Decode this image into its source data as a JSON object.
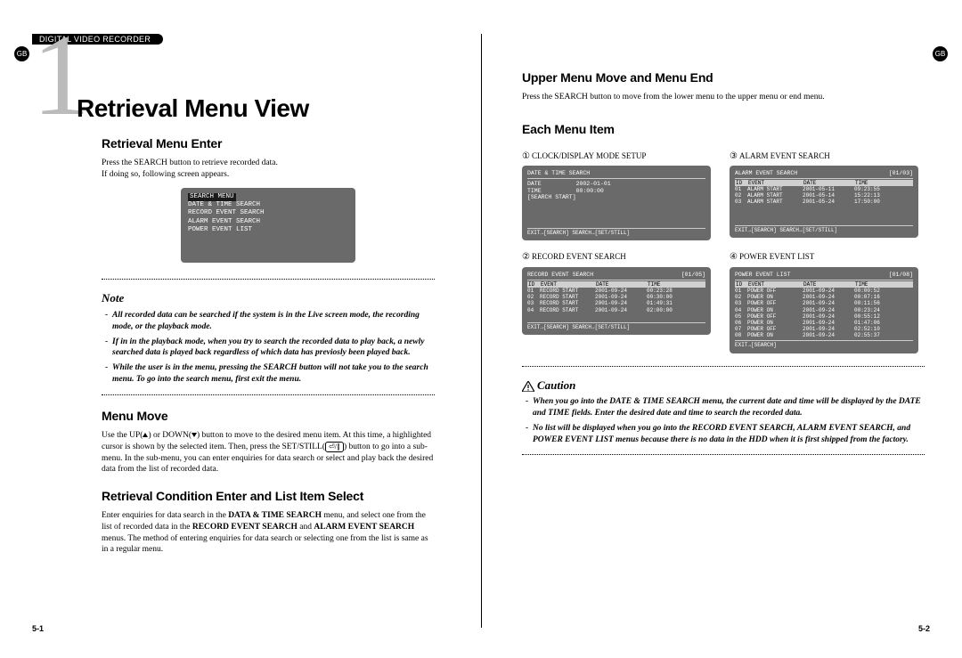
{
  "header_bar": "DIGITAL VIDEO RECORDER",
  "gb": "GB",
  "chapter_number": "1",
  "title": "Retrieval Menu View",
  "page_left": "5-1",
  "page_right": "5-2",
  "left": {
    "s1": {
      "h": "Retrieval Menu Enter",
      "p1": "Press the SEARCH button to retrieve recorded data.",
      "p2": "If doing so, following screen appears.",
      "screen": {
        "title": "SEARCH MENU",
        "items": [
          "DATE & TIME SEARCH",
          "RECORD EVENT SEARCH",
          "ALARM EVENT SEARCH",
          "POWER EVENT LIST"
        ]
      }
    },
    "note": {
      "label": "Note",
      "b1": "All recorded data can be searched if the system is in the Live screen mode, the recording mode, or the playback mode.",
      "b2": "If in in the playback mode, when you try to search the recorded data to play back, a newly searched data is played back regardless of which data has previosly been played back.",
      "b3": "While the user is in the menu, pressing the SEARCH button will not take you to the search menu. To go into the search menu, first exit the menu."
    },
    "s2": {
      "h": "Menu Move",
      "p": "Use the UP( ▲ ) or DOWN( ▼ ) button to move to the desired menu item. At this time, a highlighted cursor is shown by the selected item. Then, press the SET/STILL( ⏎/∥ ) button to go into a sub-menu. In the sub-menu, you can enter enquiries for data search or select and play back the desired data from the list of recorded data."
    },
    "s3": {
      "h": "Retrieval Condition Enter and List Item Select",
      "p1": "Enter enquiries for data search in the ",
      "b1": "DATA & TIME SEARCH",
      "p2": " menu, and select one from the list of recorded data in the ",
      "b2": "RECORD EVENT SEARCH",
      "p3": " and ",
      "b3": "ALARM EVENT SEARCH",
      "p4": " menus. The method of entering enquiries for data search or selecting one from the list is same as in a regular menu."
    }
  },
  "right": {
    "s1": {
      "h": "Upper Menu Move and Menu End",
      "p": "Press the SEARCH button to move from the lower menu to the upper menu or end menu."
    },
    "s2": {
      "h": "Each Menu Item",
      "items": [
        {
          "num": "①",
          "label": "CLOCK/DISPLAY MODE SETUP",
          "screen": {
            "title": "DATE & TIME SEARCH",
            "lines": [
              "DATE          2002-01-01",
              "TIME          00:00:00",
              "[SEARCH START]"
            ],
            "footer": "EXIT→[SEARCH] SEARCH→[SET/STILL]"
          }
        },
        {
          "num": "③",
          "label": "ALARM EVENT SEARCH",
          "screen": {
            "title": "ALARM EVENT SEARCH",
            "page": "[01/03]",
            "cols": [
              "ID",
              "EVENT",
              "DATE",
              "TIME"
            ],
            "rows": [
              [
                "01",
                "ALARM START",
                "2001-05-11",
                "09:23:55"
              ],
              [
                "02",
                "ALARM START",
                "2001-05-14",
                "15:22:13"
              ],
              [
                "03",
                "ALARM START",
                "2001-05-24",
                "17:50:00"
              ]
            ],
            "footer": "EXIT→[SEARCH] SEARCH→[SET/STILL]"
          }
        },
        {
          "num": "②",
          "label": "RECORD EVENT SEARCH",
          "screen": {
            "title": "RECORD EVENT SEARCH",
            "page": "[01/05]",
            "cols": [
              "ID",
              "EVENT",
              "DATE",
              "TIME"
            ],
            "rows": [
              [
                "01",
                "RECORD START",
                "2001-09-24",
                "00:23:28"
              ],
              [
                "02",
                "RECORD START",
                "2001-09-24",
                "00:30:00"
              ],
              [
                "03",
                "RECORD START",
                "2001-09-24",
                "01:49:31"
              ],
              [
                "04",
                "RECORD START",
                "2001-09-24",
                "02:00:00"
              ]
            ],
            "footer": "EXIT→[SEARCH] SEARCH→[SET/STILL]"
          }
        },
        {
          "num": "④",
          "label": "POWER EVENT LIST",
          "screen": {
            "title": "POWER EVENT LIST",
            "page": "[01/08]",
            "cols": [
              "ID",
              "EVENT",
              "DATE",
              "TIME"
            ],
            "rows": [
              [
                "01",
                "POWER OFF",
                "2001-09-24",
                "00:00:52"
              ],
              [
                "02",
                "POWER ON",
                "2001-09-24",
                "00:07:16"
              ],
              [
                "03",
                "POWER OFF",
                "2001-09-24",
                "00:11:56"
              ],
              [
                "04",
                "POWER ON",
                "2001-09-24",
                "00:23:24"
              ],
              [
                "05",
                "POWER OFF",
                "2001-09-24",
                "00:55:12"
              ],
              [
                "06",
                "POWER ON",
                "2001-09-24",
                "01:47:06"
              ],
              [
                "07",
                "POWER OFF",
                "2001-09-24",
                "02:52:10"
              ],
              [
                "08",
                "POWER ON",
                "2001-09-24",
                "02:55:37"
              ]
            ],
            "footer": "EXIT→[SEARCH]"
          }
        }
      ]
    },
    "caution": {
      "label": "Caution",
      "b1": "When you go into the DATE & TIME SEARCH menu, the current date and time will be displayed by the DATE and TIME fields. Enter the desired date and time to search the recorded data.",
      "b2": "No list will be displayed when you go into the RECORD EVENT SEARCH, ALARM EVENT SEARCH, and POWER EVENT LIST menus because there is no data in the HDD when it is first shipped from the factory."
    }
  }
}
